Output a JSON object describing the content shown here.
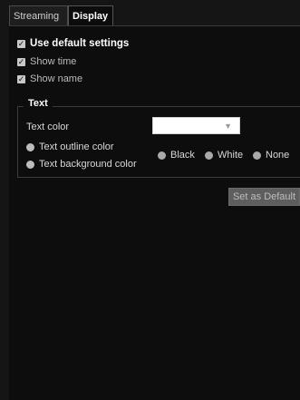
{
  "tabs": [
    {
      "label": "Streaming",
      "active": false
    },
    {
      "label": "Display",
      "active": true
    }
  ],
  "checkboxes": {
    "use_default": {
      "label": "Use default settings",
      "checked": true
    },
    "show_time": {
      "label": "Show time",
      "checked": true
    },
    "show_name": {
      "label": "Show name",
      "checked": true
    }
  },
  "text_group": {
    "legend": "Text",
    "text_color_label": "Text color",
    "text_color_value": "",
    "radios": {
      "outline": "Text outline color",
      "background": "Text background color"
    },
    "color_options": [
      "Black",
      "White",
      "None"
    ]
  },
  "set_default_button": "Set as Default",
  "check_glyph": "✓",
  "colors": {
    "panel": "#0d0d0d",
    "button": "#5e5e5e"
  }
}
